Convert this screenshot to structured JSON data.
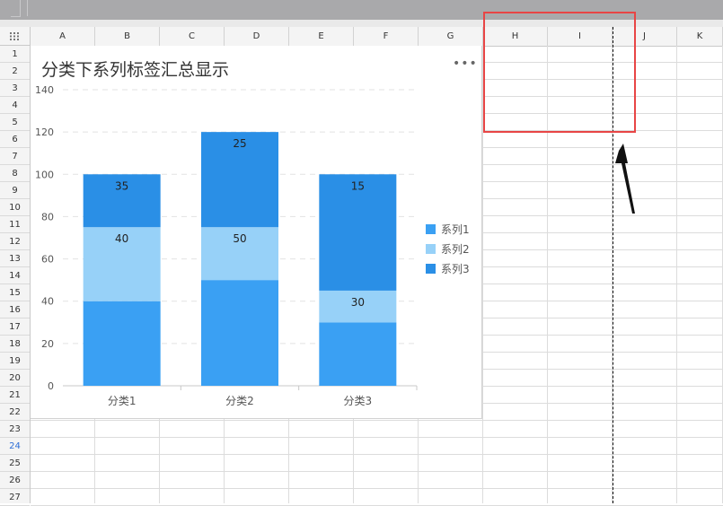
{
  "columns": [
    "A",
    "B",
    "C",
    "D",
    "E",
    "F",
    "G",
    "H",
    "I",
    "J",
    "K"
  ],
  "rows": [
    "1",
    "2",
    "3",
    "4",
    "5",
    "6",
    "7",
    "8",
    "9",
    "10",
    "11",
    "12",
    "13",
    "14",
    "15",
    "16",
    "17",
    "18",
    "19",
    "20",
    "21",
    "22",
    "23",
    "24",
    "25",
    "26",
    "27"
  ],
  "selected_row": "24",
  "chart_menu_label": "•••",
  "chart_data": {
    "type": "bar",
    "stacked": true,
    "title": "分类下系列标签汇总显示",
    "categories": [
      "分类1",
      "分类2",
      "分类3"
    ],
    "series": [
      {
        "name": "系列1",
        "values": [
          40,
          50,
          30
        ],
        "color": "#3aa0f3",
        "labels": [
          "",
          "",
          ""
        ]
      },
      {
        "name": "系列2",
        "values": [
          35,
          25,
          15
        ],
        "color": "#97d1f8",
        "labels": [
          "40",
          "50",
          "30"
        ]
      },
      {
        "name": "系列3",
        "values": [
          25,
          45,
          55
        ],
        "color": "#2a8fe6",
        "labels": [
          "35",
          "25",
          "15"
        ]
      }
    ],
    "ylim": [
      0,
      140
    ],
    "yticks": [
      0,
      20,
      40,
      60,
      80,
      100,
      120,
      140
    ],
    "grid": true,
    "legend": "right"
  },
  "colors": {
    "annotation_box": "#e84545",
    "page_break": "#111111"
  }
}
